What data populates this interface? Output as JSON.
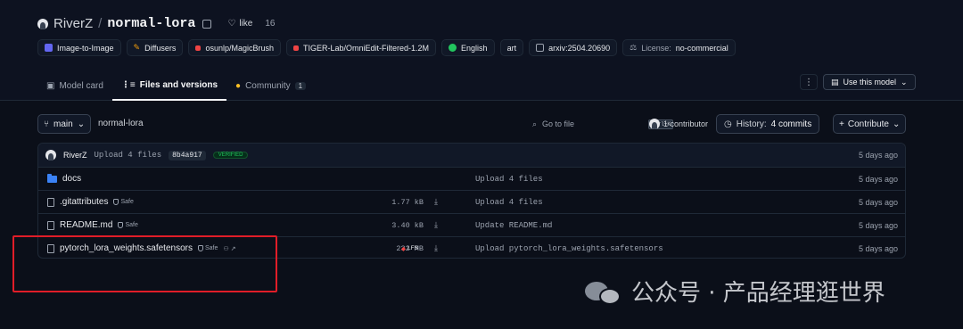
{
  "repo": {
    "owner": "RiverZ",
    "separator": "/",
    "name": "normal-lora",
    "like_label": "like",
    "like_count": "16"
  },
  "tags": [
    {
      "label": "Image-to-Image",
      "icon": "image-to-image-icon",
      "color": "#6366f1"
    },
    {
      "label": "Diffusers",
      "icon": "diffusers-icon",
      "color": "#f59e0b"
    },
    {
      "label": "osunlp/MagicBrush",
      "icon": "dataset-icon",
      "color": "#ef4444"
    },
    {
      "label": "TIGER-Lab/OmniEdit-Filtered-1.2M",
      "icon": "dataset-icon",
      "color": "#ef4444"
    },
    {
      "label": "English",
      "icon": "globe-icon",
      "color": "#22c55e"
    },
    {
      "label": "art",
      "icon": "",
      "color": ""
    },
    {
      "label": "arxiv:2504.20690",
      "icon": "paper-icon",
      "color": "#9ca3af"
    },
    {
      "label_prefix": "License:",
      "label": "no-commercial",
      "icon": "license-icon",
      "color": "#9ca3af"
    }
  ],
  "tabs": [
    {
      "label": "Model card",
      "icon": "model-card-icon"
    },
    {
      "label": "Files and versions",
      "icon": "files-icon",
      "active": true
    },
    {
      "label": "Community",
      "icon": "community-icon",
      "count": "1"
    }
  ],
  "actions": {
    "more": "⋮",
    "use_model": "Use this model"
  },
  "toolbar": {
    "branch": "main",
    "path": "normal-lora",
    "goto_placeholder": "Go to file",
    "goto_shortcut": "Ctrl+K",
    "contributors": "1 contributor",
    "history_prefix": "History:",
    "history_count": "4 commits",
    "contribute": "Contribute"
  },
  "last_commit": {
    "author": "RiverZ",
    "message": "Upload 4 files",
    "hash": "8b4a917",
    "badge": "VERIFIED",
    "time": "5 days ago"
  },
  "files": [
    {
      "name": "docs",
      "type": "folder",
      "safe": "",
      "size": "",
      "lfs": "",
      "commit": "Upload 4 files",
      "time": "5 days ago"
    },
    {
      "name": ".gitattributes",
      "type": "file",
      "safe": "Safe",
      "size": "1.77 kB",
      "lfs": "",
      "commit": "Upload 4 files",
      "time": "5 days ago"
    },
    {
      "name": "README.md",
      "type": "file",
      "safe": "Safe",
      "size": "3.40 kB",
      "lfs": "",
      "commit": "Update README.md",
      "time": "5 days ago"
    },
    {
      "name": "pytorch_lora_weights.safetensors",
      "type": "file",
      "safe": "Safe",
      "size": "232 MB",
      "lfs": "LFS",
      "commit": "Upload pytorch_lora_weights.safetensors",
      "time": "5 days ago"
    }
  ],
  "watermark": {
    "text": "公众号 · 产品经理逛世界",
    "icon": "wechat-icon"
  },
  "colors": {
    "background": "#0b0f19",
    "highlight": "#e11d28",
    "folder": "#3b82f6",
    "verified": "#22c55e"
  }
}
